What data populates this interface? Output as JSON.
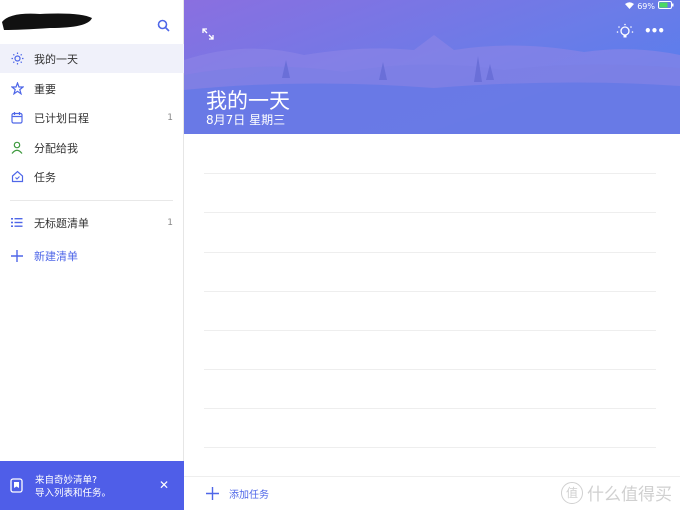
{
  "sidebar": {
    "items": [
      {
        "label": "我的一天",
        "count": ""
      },
      {
        "label": "重要",
        "count": ""
      },
      {
        "label": "已计划日程",
        "count": "1"
      },
      {
        "label": "分配给我",
        "count": ""
      },
      {
        "label": "任务",
        "count": ""
      }
    ],
    "lists": [
      {
        "label": "无标题清单",
        "count": "1"
      }
    ],
    "new_list": "新建清单"
  },
  "banner": {
    "line1": "来自奇妙清单?",
    "line2": "导入列表和任务。"
  },
  "status": {
    "battery": "69%"
  },
  "main": {
    "title": "我的一天",
    "date": "8月7日 星期三",
    "add_task": "添加任务"
  },
  "watermark": {
    "badge": "值",
    "text": "什么值得买"
  },
  "colors": {
    "accent": "#4f67e8",
    "banner": "#4f5ee8"
  }
}
